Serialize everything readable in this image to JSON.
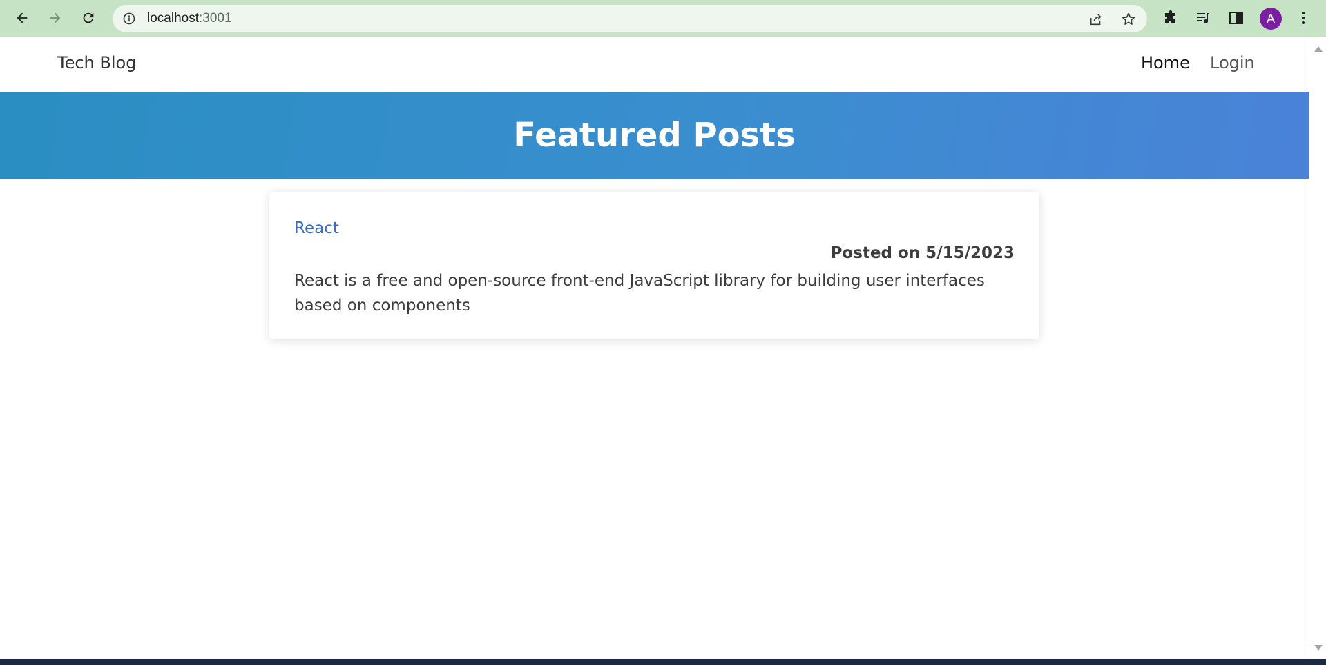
{
  "browser": {
    "url_host": "localhost",
    "url_port": ":3001",
    "avatar_letter": "A"
  },
  "site": {
    "brand": "Tech Blog",
    "nav": [
      {
        "label": "Home"
      },
      {
        "label": "Login"
      }
    ]
  },
  "hero": {
    "title": "Featured Posts",
    "colors": [
      "#2a8ec2",
      "#4a82d8"
    ]
  },
  "posts": [
    {
      "title": "React",
      "meta": "Posted on 5/15/2023",
      "body": "React is a free and open-source front-end JavaScript library for building user interfaces based on components"
    }
  ],
  "colors": {
    "chrome": "#c7e3c6",
    "link": "#3b6ec2",
    "avatar": "#7b1fa2"
  }
}
